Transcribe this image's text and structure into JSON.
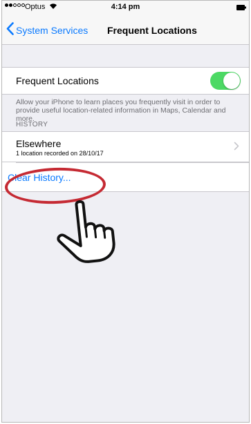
{
  "status_bar": {
    "carrier": "Optus",
    "time": "4:14 pm",
    "signal_strength": 2,
    "signal_max": 5,
    "wifi_icon": "wifi-icon",
    "battery_icon": "battery-icon"
  },
  "nav": {
    "back_label": "System Services",
    "back_icon": "chevron-left-icon",
    "title": "Frequent Locations"
  },
  "frequent_locations": {
    "label": "Frequent Locations",
    "toggle_on": true,
    "footer": "Allow your iPhone to learn places you frequently visit in order to provide useful location-related information in Maps, Calendar and more."
  },
  "history": {
    "header": "HISTORY",
    "items": [
      {
        "title": "Elsewhere",
        "subtitle": "1 location recorded on 28/10/17"
      }
    ],
    "clear_label": "Clear History..."
  },
  "annotations": {
    "highlight_color": "#c52a33",
    "pointer_icon": "pointing-hand-icon"
  },
  "colors": {
    "accent": "#0a7aff",
    "toggle_on": "#4cd964",
    "background": "#efeff4"
  }
}
